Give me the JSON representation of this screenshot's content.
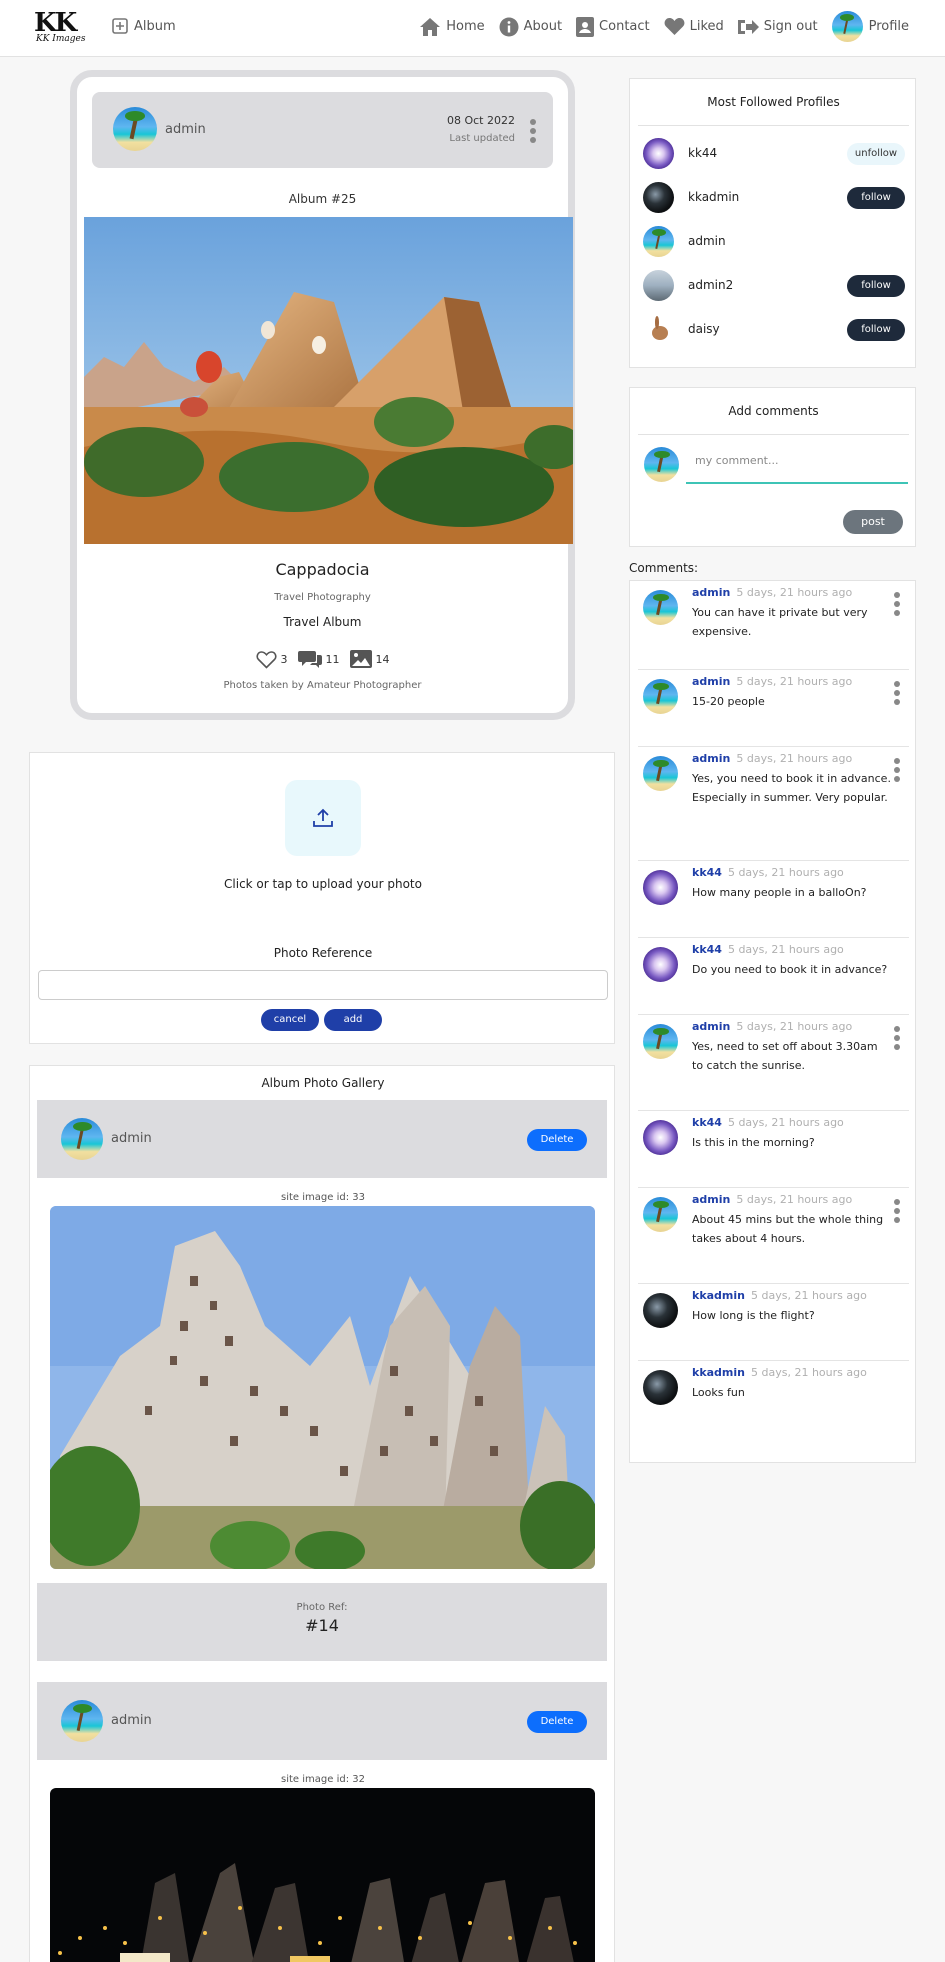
{
  "nav": {
    "logo_mark": "KK",
    "logo_text": "KK Images",
    "album_link": "Album",
    "items": [
      {
        "label": "Home",
        "icon": "home-icon"
      },
      {
        "label": "About",
        "icon": "info-icon"
      },
      {
        "label": "Contact",
        "icon": "contact-icon"
      },
      {
        "label": "Liked",
        "icon": "heart-icon"
      },
      {
        "label": "Sign out",
        "icon": "sign-out-icon"
      }
    ],
    "profile_label": "Profile"
  },
  "album": {
    "owner": "admin",
    "date": "08 Oct 2022",
    "last_updated": "Last updated",
    "number": "Album #25",
    "title": "Cappadocia",
    "category": "Travel Photography",
    "type": "Travel Album",
    "likes": "3",
    "comments": "11",
    "photos": "14",
    "footer": "Photos taken by Amateur Photographer"
  },
  "upload": {
    "prompt": "Click or tap to upload your photo",
    "reference_label": "Photo Reference",
    "cancel_label": "cancel",
    "add_label": "add"
  },
  "gallery": {
    "title": "Album Photo Gallery",
    "delete_label": "Delete",
    "photo_ref_label": "Photo Ref:",
    "items": [
      {
        "owner": "admin",
        "site_image": "site image id: 33",
        "ref": "#14"
      },
      {
        "owner": "admin",
        "site_image": "site image id: 32",
        "ref": ""
      }
    ]
  },
  "followed": {
    "title": "Most Followed Profiles",
    "profiles": [
      {
        "name": "kk44",
        "button": "unfollow"
      },
      {
        "name": "kkadmin",
        "button": "follow"
      },
      {
        "name": "admin",
        "button": ""
      },
      {
        "name": "admin2",
        "button": "follow"
      },
      {
        "name": "daisy",
        "button": "follow"
      }
    ]
  },
  "add_comment": {
    "title": "Add comments",
    "placeholder": "my comment...",
    "post_label": "post"
  },
  "comments": {
    "label": "Comments:",
    "items": [
      {
        "user": "admin",
        "time": "5 days, 21 hours ago",
        "text": "You can have it private but very expensive."
      },
      {
        "user": "admin",
        "time": "5 days, 21 hours ago",
        "text": "15-20 people"
      },
      {
        "user": "admin",
        "time": "5 days, 21 hours ago",
        "text": "Yes, you need to book it in advance. Especially in summer. Very popular."
      },
      {
        "user": "kk44",
        "time": "5 days, 21 hours ago",
        "text": "How many people in a balloOn?"
      },
      {
        "user": "kk44",
        "time": "5 days, 21 hours ago",
        "text": "Do you need to book it in advance?"
      },
      {
        "user": "admin",
        "time": "5 days, 21 hours ago",
        "text": "Yes, need to set off about 3.30am to catch the sunrise."
      },
      {
        "user": "kk44",
        "time": "5 days, 21 hours ago",
        "text": "Is this in the morning?"
      },
      {
        "user": "admin",
        "time": "5 days, 21 hours ago",
        "text": "About 45 mins but the whole thing takes about 4 hours."
      },
      {
        "user": "kkadmin",
        "time": "5 days, 21 hours ago",
        "text": "How long is the flight?"
      },
      {
        "user": "kkadmin",
        "time": "5 days, 21 hours ago",
        "text": "Looks fun"
      }
    ]
  },
  "colors": {
    "primary_button": "#1f3fa8",
    "delete_button": "#0d6efd",
    "follow_button": "#1e2a3b",
    "comment_user": "#1f3fa8",
    "input_underline": "#3ec4b6"
  }
}
